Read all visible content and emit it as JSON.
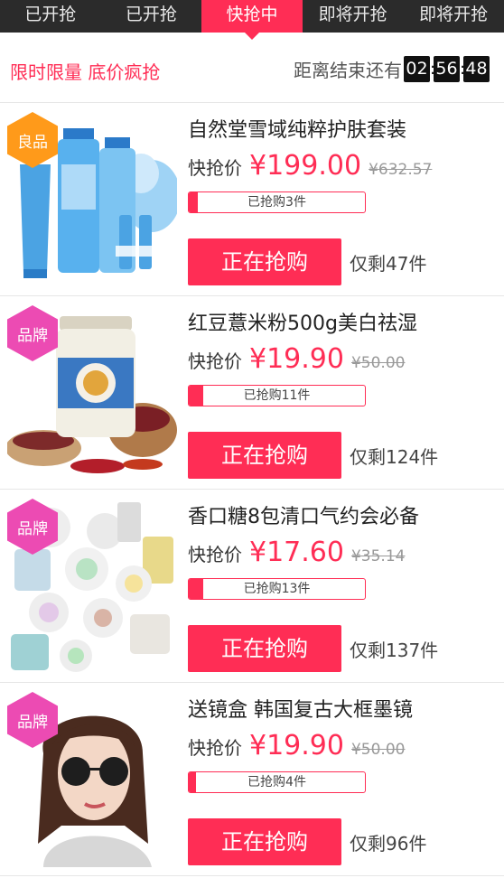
{
  "tabs": [
    {
      "label": "已开抢"
    },
    {
      "label": "已开抢"
    },
    {
      "label": "快抢中"
    },
    {
      "label": "即将开抢"
    },
    {
      "label": "即将开抢"
    }
  ],
  "active_tab_index": 2,
  "subheader": {
    "promo": "限时限量 底价疯抢",
    "countdown_label": "距离结束还有",
    "countdown": {
      "hours": "02",
      "minutes": "56",
      "seconds": "48"
    }
  },
  "colors": {
    "accent": "#ff2d55",
    "badge_orange": "#ff9a1a",
    "badge_pink": "#ec4bb3",
    "tabbar": "#2b2b2b"
  },
  "products": [
    {
      "badge": "良品",
      "badge_color": "orange",
      "title": "自然堂雪域纯粹护肤套装",
      "price_label": "快抢价",
      "price": "¥199.00",
      "original_price": "¥632.57",
      "sold_text": "已抢购3件",
      "sold_fraction": 0.05,
      "buy_label": "正在抢购",
      "remaining": "仅剩47件",
      "image_icon": "skincare-set-image"
    },
    {
      "badge": "品牌",
      "badge_color": "pink",
      "title": "红豆薏米粉500g美白祛湿",
      "price_label": "快抢价",
      "price": "¥19.90",
      "original_price": "¥50.00",
      "sold_text": "已抢购11件",
      "sold_fraction": 0.08,
      "buy_label": "正在抢购",
      "remaining": "仅剩124件",
      "image_icon": "grain-powder-jar-image"
    },
    {
      "badge": "品牌",
      "badge_color": "pink",
      "title": "香口糖8包清口气约会必备",
      "price_label": "快抢价",
      "price": "¥17.60",
      "original_price": "¥35.14",
      "sold_text": "已抢购13件",
      "sold_fraction": 0.08,
      "buy_label": "正在抢购",
      "remaining": "仅剩137件",
      "image_icon": "candy-packs-image"
    },
    {
      "badge": "品牌",
      "badge_color": "pink",
      "title": "送镜盒 韩国复古大框墨镜",
      "price_label": "快抢价",
      "price": "¥19.90",
      "original_price": "¥50.00",
      "sold_text": "已抢购4件",
      "sold_fraction": 0.04,
      "buy_label": "正在抢购",
      "remaining": "仅剩96件",
      "image_icon": "sunglasses-model-image"
    }
  ]
}
